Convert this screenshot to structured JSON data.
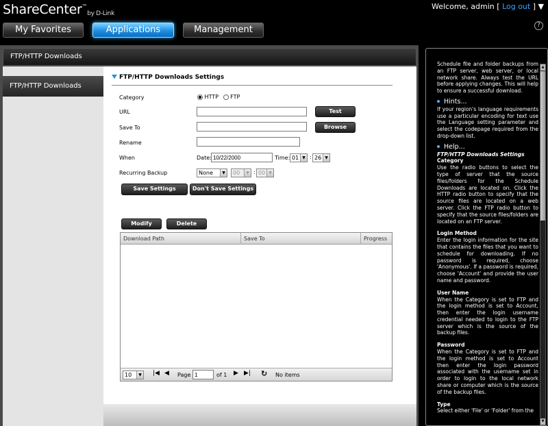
{
  "header": {
    "logo_main": "ShareCenter",
    "logo_tm": "™",
    "logo_by": "by D-Link",
    "welcome_prefix": "Welcome, admin [",
    "logout": "Log out",
    "welcome_suffix": "]",
    "menu_arrow": "▼",
    "help_icon": "?",
    "tabs": [
      {
        "label": "My Favorites",
        "active": false
      },
      {
        "label": "Applications",
        "active": true
      },
      {
        "label": "Management",
        "active": false
      }
    ]
  },
  "page": {
    "title": "FTP/HTTP Downloads"
  },
  "sidebar": {
    "items": [
      {
        "label": "FTP/HTTP Downloads",
        "selected": true
      }
    ]
  },
  "form": {
    "section_title": "FTP/HTTP Downloads Settings",
    "category_label": "Category",
    "category_options": [
      "HTTP",
      "FTP"
    ],
    "category_selected": "HTTP",
    "url_label": "URL",
    "url_value": "",
    "test_button": "Test",
    "save_to_label": "Save To",
    "save_to_value": "",
    "browse_button": "Browse",
    "rename_label": "Rename",
    "rename_value": "",
    "when_label": "When",
    "date_label": "Date:",
    "date_value": "10/22/2000",
    "time_label": "Time:",
    "time_hour": "01",
    "time_minute": "26",
    "recurring_label": "Recurring Backup",
    "recurring_value": "None",
    "recurring_hour": "00",
    "recurring_minute": "00",
    "colon": ":",
    "save_settings": "Save Settings",
    "dont_save_settings": "Don't Save Settings"
  },
  "list": {
    "modify_button": "Modify",
    "delete_button": "Delete",
    "columns": [
      "Download Path",
      "Save To",
      "Progress"
    ],
    "rows": [],
    "pager": {
      "page_size": "10",
      "page_label": "Page",
      "page_value": "1",
      "of_label": "of 1",
      "status": "No items"
    }
  },
  "help": {
    "intro": "Schedule file and folder backups from an FTP server, web server, or local network share. Always test the URL before applying changes. This will help to ensure a successful download.",
    "hints_title": "Hints...",
    "hints_text": "If your region's language requirements use a particular encoding for text use the Language setting parameter and select the codepage required from the drop-down list.",
    "help_title": "Help...",
    "help_subtitle": "FTP/HTTP Downloads Settings",
    "topics": [
      {
        "title": "Category",
        "text": "Use the radio buttons to select the type of server that the source files/folders for the Schedule Downloads are located on. Click the HTTP radio button to specify that the source files are located on a web server. Click the FTP radio button to specify that the source files/folders are located on an FTP server."
      },
      {
        "title": "Login Method",
        "text": "Enter the login information for the site that contains the files that you want to schedule for downloading. If no password is required, choose 'Anonymous'. If a password is required, choose 'Account' and provide the user name and password."
      },
      {
        "title": "User Name",
        "text": "When the Category is set to FTP and the login method is set to Account, then enter the login username credential needed to login to the FTP server which is the source of the backup files."
      },
      {
        "title": "Password",
        "text": "When the Category is set to FTP and the login method is set to Account then enter the login password associated with the username set in order to login to the local network share or computer which is the source of the backup files."
      },
      {
        "title": "Type",
        "text": "Select either 'File' or 'Folder' from the"
      }
    ]
  }
}
